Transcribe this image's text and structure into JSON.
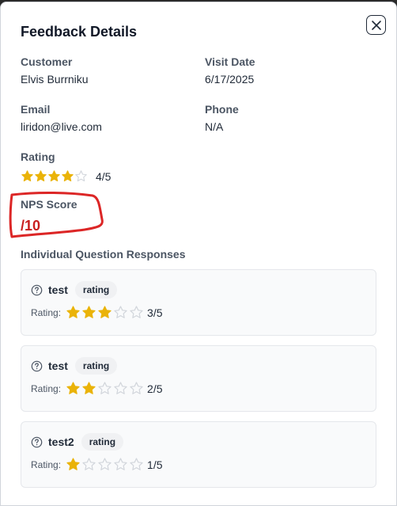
{
  "modal": {
    "title": "Feedback Details",
    "close_icon": "close-icon"
  },
  "customer": {
    "label": "Customer",
    "value": "Elvis Burrniku"
  },
  "visit_date": {
    "label": "Visit Date",
    "value": "6/17/2025"
  },
  "email": {
    "label": "Email",
    "value": "liridon@live.com"
  },
  "phone": {
    "label": "Phone",
    "value": "N/A"
  },
  "rating": {
    "label": "Rating",
    "value": 4,
    "max": 5,
    "text": "4/5"
  },
  "nps": {
    "label": "NPS Score",
    "value": "/10"
  },
  "responses": {
    "label": "Individual Question Responses",
    "rating_prefix": "Rating:",
    "items": [
      {
        "title": "test",
        "type": "rating",
        "value": 3,
        "max": 5,
        "text": "3/5"
      },
      {
        "title": "test",
        "type": "rating",
        "value": 2,
        "max": 5,
        "text": "2/5"
      },
      {
        "title": "test2",
        "type": "rating",
        "value": 1,
        "max": 5,
        "text": "1/5"
      }
    ]
  },
  "colors": {
    "star_filled": "#eab308",
    "star_empty": "#d1d5db",
    "nps_value": "#c81e1e",
    "annotation": "#dc2626"
  }
}
